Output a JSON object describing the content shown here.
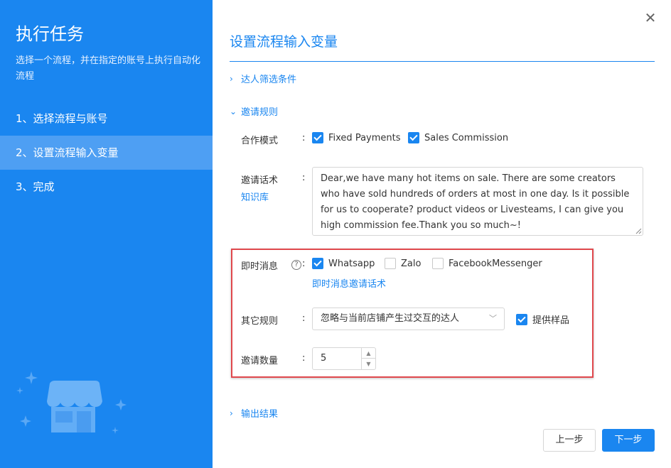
{
  "sidebar": {
    "title": "执行任务",
    "description": "选择一个流程，并在指定的账号上执行自动化流程",
    "steps": [
      {
        "label": "1、选择流程与账号"
      },
      {
        "label": "2、设置流程输入变量"
      },
      {
        "label": "3、完成"
      }
    ],
    "active_step": 2
  },
  "dialog": {
    "close_icon": "close-icon",
    "title": "设置流程输入变量",
    "sections": {
      "filter": "达人筛选条件",
      "invite": "邀请规则",
      "output": "输出结果"
    },
    "coop_mode": {
      "label": "合作模式",
      "options": [
        {
          "label": "Fixed Payments",
          "checked": true
        },
        {
          "label": "Sales Commission",
          "checked": true
        }
      ]
    },
    "invite_script": {
      "label": "邀请话术",
      "link": "知识库",
      "value": "Dear,we have many hot items on sale. There are some creators who have sold hundreds of orders at most in one day. Is it possible for us to cooperate? product videos or Livesteams, I can give you high commission fee.Thank you so much~!"
    },
    "im": {
      "label": "即时消息",
      "help_icon": "question-circle-icon",
      "options": [
        {
          "label": "Whatsapp",
          "checked": true
        },
        {
          "label": "Zalo",
          "checked": false
        },
        {
          "label": "FacebookMessenger",
          "checked": false
        }
      ],
      "link": "即时消息邀请话术"
    },
    "other_rules": {
      "label": "其它规则",
      "select_value": "忽略与当前店铺产生过交互的达人",
      "sample": {
        "label": "提供样品",
        "checked": true
      }
    },
    "invite_count": {
      "label": "邀请数量",
      "value": "5"
    },
    "buttons": {
      "prev": "上一步",
      "next": "下一步"
    },
    "colors": {
      "accent": "#1a86f0",
      "highlight": "#e0484d"
    }
  }
}
